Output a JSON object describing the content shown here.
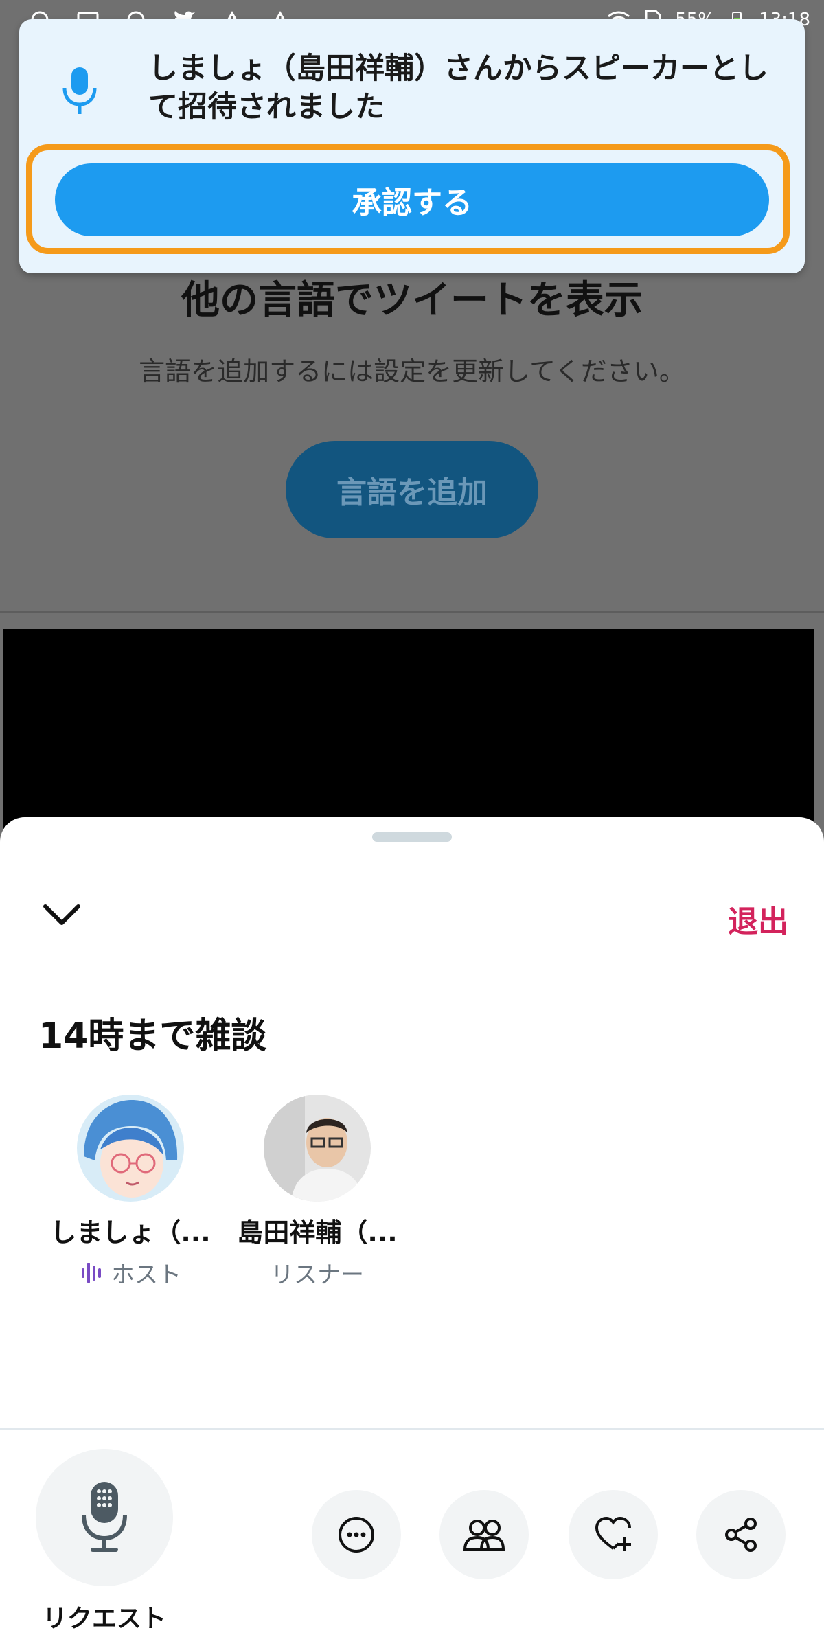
{
  "status_bar": {
    "battery": "55%",
    "time": "13:18"
  },
  "background": {
    "heading": "他の言語でツイートを表示",
    "subtext": "言語を追加するには設定を更新してください。",
    "add_language_label": "言語を追加"
  },
  "notification": {
    "icon": "microphone-icon",
    "message": "しましょ（島田祥輔）さんからスピーカーとして招待されました",
    "accept_label": "承認する",
    "highlight_color": "#f59a1a",
    "button_color": "#1d9bf0"
  },
  "space": {
    "leave_label": "退出",
    "title": "14時まで雑談",
    "participants": [
      {
        "name": "しましょ（...",
        "role": "ホスト",
        "role_icon": "speaking-bars-icon"
      },
      {
        "name": "島田祥輔（...",
        "role": "リスナー"
      }
    ],
    "request_label": "リクエスト",
    "accent_color": "#d3235c"
  },
  "actions": [
    "more-icon",
    "people-icon",
    "heart-plus-icon",
    "share-icon"
  ]
}
